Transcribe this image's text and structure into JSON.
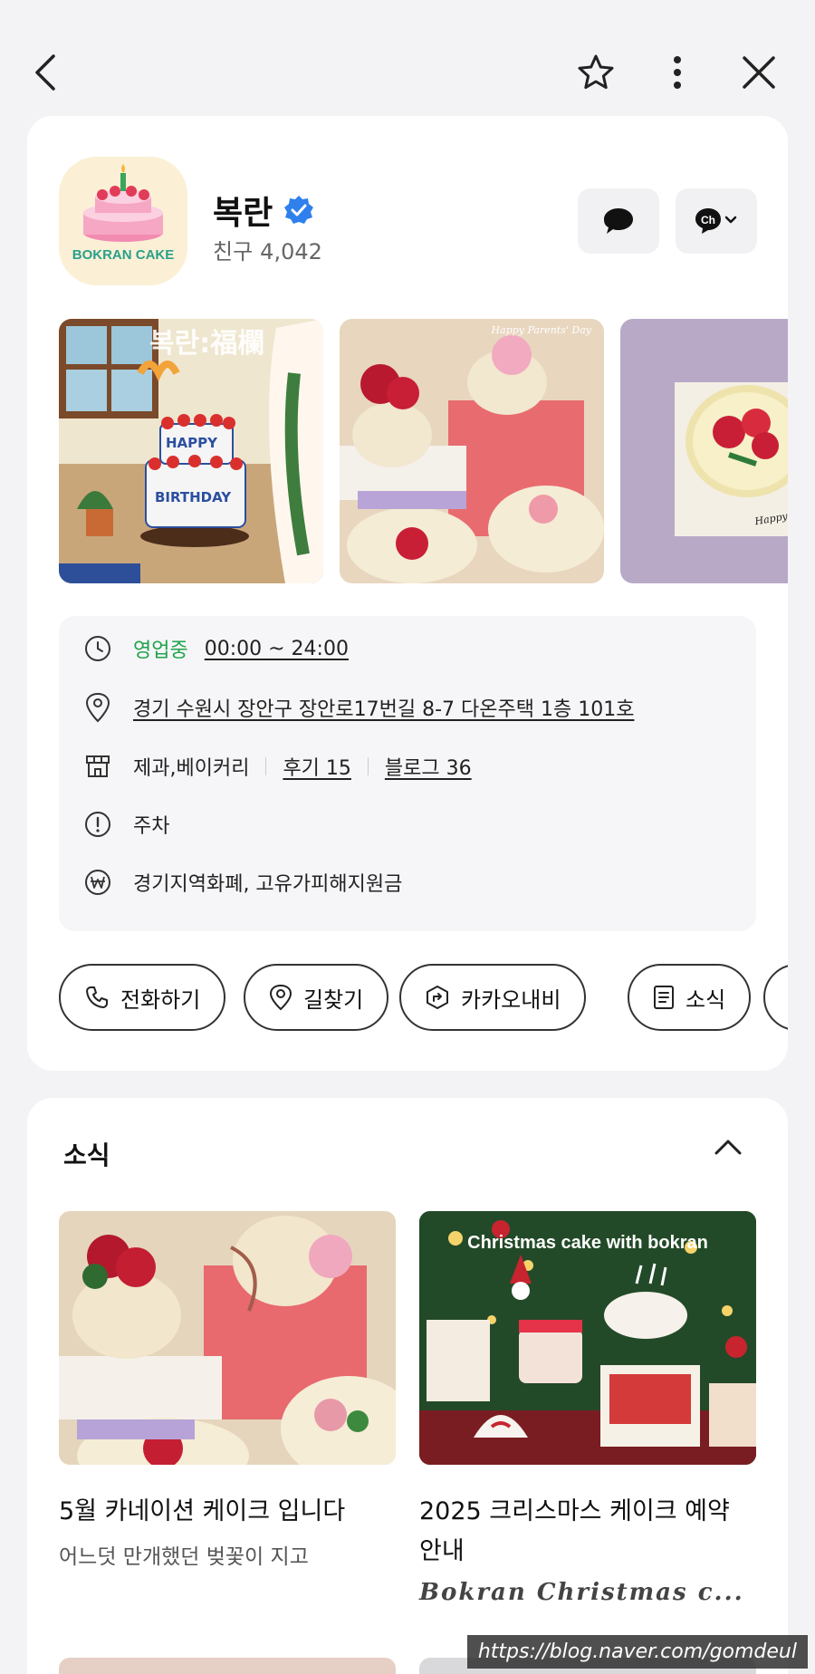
{
  "profile": {
    "name": "복란",
    "friends_label": "친구",
    "friends_count": "4,042",
    "avatar_text": "BOKRAN CAKE"
  },
  "gallery": {
    "tile1_overlay": "복란:福欄",
    "tile1_cake_top": "HAPPY",
    "tile1_cake_bottom": "BIRTHDAY",
    "tile2_overlay": "Happy Parents' Day",
    "tile3_overlay": "Happy Parents'"
  },
  "info": {
    "status": "영업중",
    "hours": "00:00 ~ 24:00",
    "address": "경기 수원시 장안구 장안로17번길 8-7 다온주택 1층 101호",
    "category": "제과,베이커리",
    "reviews": "후기 15",
    "blog": "블로그 36",
    "parking": "주차",
    "payment": "경기지역화폐, 고유가피해지원금"
  },
  "actions": {
    "call": "전화하기",
    "directions": "길찾기",
    "kakao_navi": "카카오내비",
    "news": "소식"
  },
  "news": {
    "title": "소식",
    "posts": [
      {
        "title": "5월 카네이션 케이크 입니다",
        "subtitle": "어느덧 만개했던 벚꽃이 지고"
      },
      {
        "title": "2025 크리스마스 케이크 예약 안내",
        "subtitle": "Bokran Christmas c...",
        "thumb_caption": "Christmas cake with bokran"
      }
    ]
  },
  "watermark": "https://blog.naver.com/gomdeul",
  "colors": {
    "accent_green": "#1fa34a",
    "verified_blue": "#2f80ed",
    "background": "#f3f3f5"
  }
}
